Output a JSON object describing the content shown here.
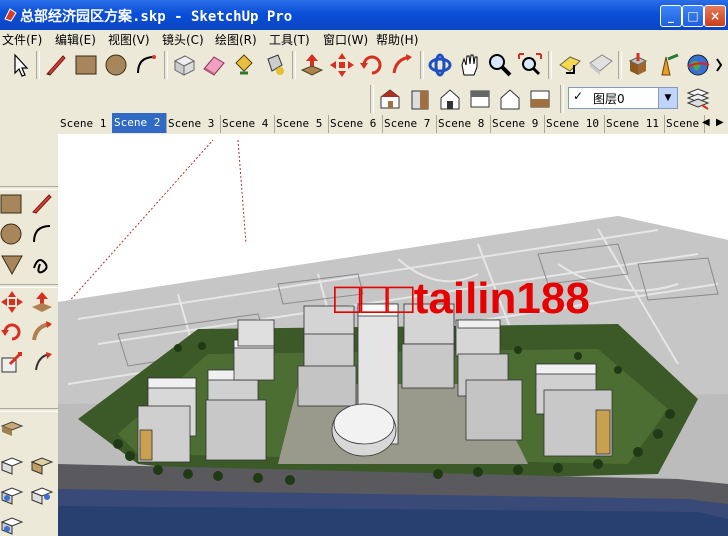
{
  "window": {
    "title": "总部经济园区方案.skp - SketchUp Pro",
    "controls": [
      "_",
      "□",
      "×"
    ]
  },
  "menu": [
    "文件(F)",
    "编辑(E)",
    "视图(V)",
    "镜头(C)",
    "绘图(R)",
    "工具(T)",
    "窗口(W)",
    "帮助(H)"
  ],
  "toolbar_top": {
    "tools": [
      "select-icon",
      "pencil-icon",
      "rectangle-icon",
      "circle-icon",
      "arc-icon",
      "eraser-cube-icon",
      "eraser-icon",
      "paint-bucket-icon",
      "paint-icon",
      "push-pull-icon",
      "move-icon",
      "rotate-icon",
      "follow-me-icon",
      "orbit-icon",
      "pan-icon",
      "zoom-icon",
      "zoom-extents-icon",
      "section-icon",
      "section-fill-icon",
      "get-models-icon",
      "share-model-icon",
      "google-earth-icon"
    ]
  },
  "toolbar_views": {
    "tools": [
      "iso-view-icon",
      "front-view-icon",
      "top-view-icon",
      "right-view-icon",
      "back-view-icon",
      "left-view-icon"
    ],
    "layer": {
      "check": "✓",
      "label": "图层0",
      "arrow": "▼"
    },
    "layer_manager_icon": "layers-icon"
  },
  "scenes": {
    "tabs": [
      "Scene 1",
      "Scene 2",
      "Scene 3",
      "Scene 4",
      "Scene 5",
      "Scene 6",
      "Scene 7",
      "Scene 8",
      "Scene 9",
      "Scene 10",
      "Scene 11",
      "Scene"
    ],
    "active_index": 1,
    "scroll_left": "◀",
    "scroll_right": "▶"
  },
  "viewport": {
    "watermark": "□□□tailin188"
  },
  "colors": {
    "titlebar": "#0a4fd8",
    "active_tab": "#316ac5",
    "watermark": "#e60000",
    "chrome": "#ece9d8"
  }
}
